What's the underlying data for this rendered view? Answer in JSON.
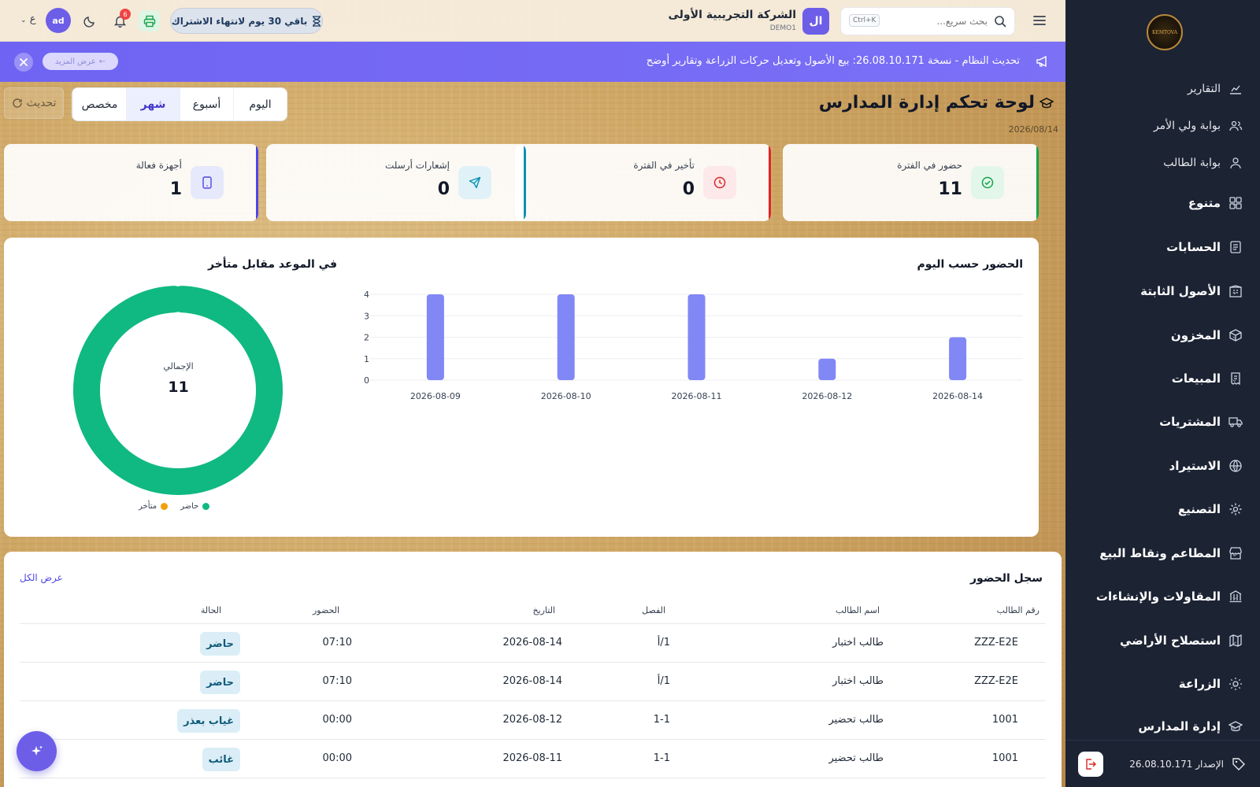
{
  "topbar": {
    "search_placeholder": "بحث سريع...",
    "search_shortcut": "Ctrl+K",
    "company_initial": "ال",
    "company_name": "الشركة التجريبية الأولى",
    "company_code": "DEMO1",
    "trial_text": "باقي 30 يوم لانتهاء الاشتراك",
    "notification_count": "6",
    "avatar_initials": "ad",
    "language": "ع"
  },
  "banner": {
    "message": "تحديث النظام - نسخة 26.08.10.171: بيع الأصول وتعديل حركات الزراعة وتقارير أوضح",
    "more_label": "عرض المزيد"
  },
  "page": {
    "title": "لوحة تحكم إدارة المدارس",
    "date": "2026/08/14",
    "periods": [
      "اليوم",
      "أسبوع",
      "شهر",
      "مخصص"
    ],
    "active_period": "شهر",
    "refresh_label": "تحديث"
  },
  "kpis": [
    {
      "label": "حضور في الفترة",
      "value": "11",
      "icon": "check-circle-icon",
      "color": "#16a34a",
      "bg": "#e3f6ea"
    },
    {
      "label": "تأخير في الفترة",
      "value": "0",
      "icon": "clock-icon",
      "color": "#dc2626",
      "bg": "#fde8ea"
    },
    {
      "label": "إشعارات أرسلت",
      "value": "0",
      "icon": "send-icon",
      "color": "#0891b2",
      "bg": "#e0f2f8"
    },
    {
      "label": "أجهزة فعالة",
      "value": "1",
      "icon": "tablet-icon",
      "color": "#4f46e5",
      "bg": "#e6e8fb"
    }
  ],
  "bar_chart": {
    "title": "الحضور حسب اليوم"
  },
  "donut_chart": {
    "title": "في الموعد مقابل متأخر",
    "center_label": "الإجمالي",
    "center_value": "11",
    "legend": [
      "حاضر",
      "متأخر"
    ]
  },
  "chart_data": [
    {
      "type": "bar",
      "title": "الحضور حسب اليوم",
      "categories": [
        "2026-08-09",
        "2026-08-10",
        "2026-08-11",
        "2026-08-12",
        "2026-08-14"
      ],
      "values": [
        4,
        4,
        4,
        1,
        2
      ],
      "ylim": [
        0,
        4
      ],
      "yticks": [
        0,
        1,
        2,
        3,
        4
      ],
      "color": "#8187f5",
      "grid": true
    },
    {
      "type": "pie",
      "title": "في الموعد مقابل متأخر",
      "labels": [
        "حاضر",
        "متأخر"
      ],
      "values": [
        11,
        0
      ],
      "colors": [
        "#10b981",
        "#f59e0b"
      ]
    }
  ],
  "attendance": {
    "title": "سجل الحضور",
    "view_all": "عرض الكل",
    "columns": [
      "رقم الطالب",
      "اسم الطالب",
      "الفصل",
      "التاريخ",
      "الحضور",
      "الحالة"
    ],
    "rows": [
      {
        "id": "ZZZ-E2E",
        "name": "طالب اختبار",
        "class": "1/أ",
        "date": "2026-08-14",
        "time": "07:10",
        "status": "حاضر"
      },
      {
        "id": "ZZZ-E2E",
        "name": "طالب اختبار",
        "class": "1/أ",
        "date": "2026-08-14",
        "time": "07:10",
        "status": "حاضر"
      },
      {
        "id": "1001",
        "name": "طالب تحضير",
        "class": "1-1",
        "date": "2026-08-12",
        "time": "00:00",
        "status": "غياب بعذر"
      },
      {
        "id": "1001",
        "name": "طالب تحضير",
        "class": "1-1",
        "date": "2026-08-11",
        "time": "00:00",
        "status": "غائب"
      }
    ]
  },
  "sidebar": {
    "logo_text": "KEMTOVA",
    "items": [
      {
        "label": "التقارير",
        "icon": "chart-line-icon",
        "group": false
      },
      {
        "label": "بوابة ولي الأمر",
        "icon": "users-icon",
        "group": false
      },
      {
        "label": "بوابة الطالب",
        "icon": "user-icon",
        "group": false
      },
      {
        "label": "متنوع",
        "icon": "grid-icon",
        "group": true
      },
      {
        "label": "الحسابات",
        "icon": "ledger-icon",
        "group": true
      },
      {
        "label": "الأصول الثابتة",
        "icon": "building-icon",
        "group": true
      },
      {
        "label": "المخزون",
        "icon": "box-icon",
        "group": true
      },
      {
        "label": "المبيعات",
        "icon": "receipt-icon",
        "group": true
      },
      {
        "label": "المشتريات",
        "icon": "truck-icon",
        "group": true
      },
      {
        "label": "الاستيراد",
        "icon": "globe-icon",
        "group": true
      },
      {
        "label": "التصنيع",
        "icon": "gear-icon",
        "group": true
      },
      {
        "label": "المطاعم ونقاط البيع",
        "icon": "store-icon",
        "group": true
      },
      {
        "label": "المقاولات والإنشاءات",
        "icon": "bank-icon",
        "group": true
      },
      {
        "label": "استصلاح الأراضي",
        "icon": "map-icon",
        "group": true
      },
      {
        "label": "الزراعة",
        "icon": "sun-icon",
        "group": true
      },
      {
        "label": "إدارة المدارس",
        "icon": "graduation-cap-icon",
        "group": true
      }
    ],
    "version_label": "الإصدار 26.08.10.171"
  }
}
